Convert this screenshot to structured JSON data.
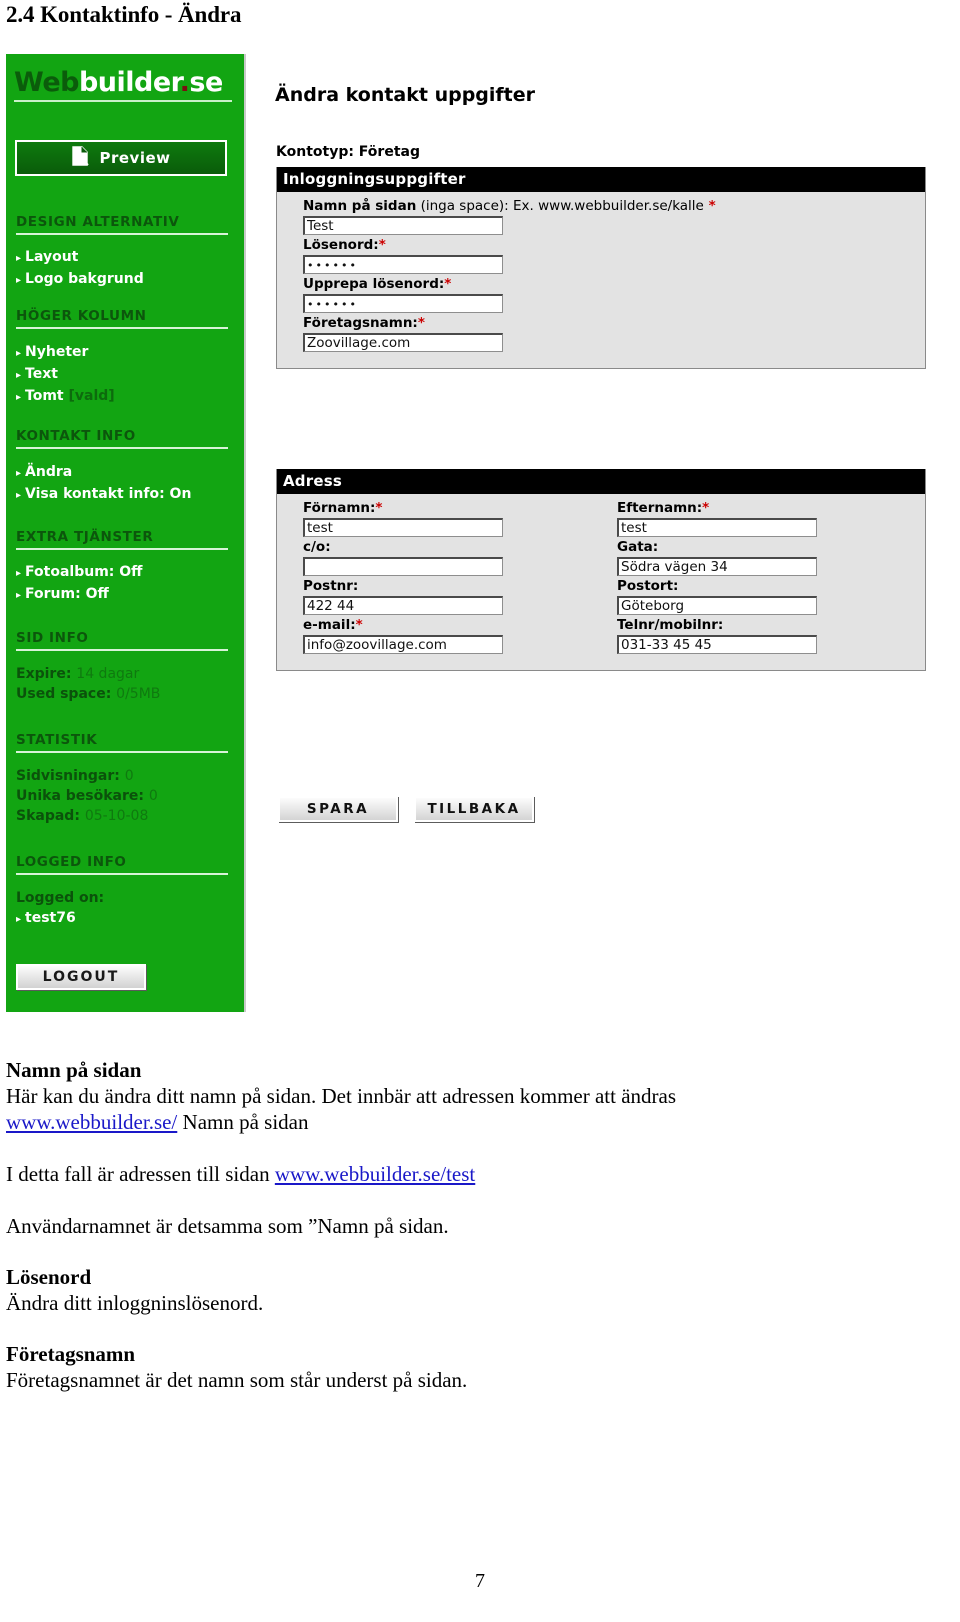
{
  "document": {
    "heading": "2.4 Kontaktinfo - Ändra",
    "page_number": "7"
  },
  "screenshot": {
    "sidebar": {
      "logo": {
        "part1": "Web",
        "part2": "builder",
        "dot": ".",
        "part3": "se"
      },
      "preview_button": {
        "label": "Preview",
        "icon": "page-preview-icon"
      },
      "sections": [
        {
          "title": "DESIGN ALTERNATIV",
          "items": [
            {
              "label": "Layout",
              "suffix": ""
            },
            {
              "label": "Logo bakgrund",
              "suffix": ""
            }
          ]
        },
        {
          "title": "HÖGER KOLUMN",
          "items": [
            {
              "label": "Nyheter",
              "suffix": ""
            },
            {
              "label": "Text",
              "suffix": ""
            },
            {
              "label": "Tomt",
              "suffix": "[vald]"
            }
          ]
        },
        {
          "title": "KONTAKT INFO",
          "items": [
            {
              "label": "Ändra",
              "suffix": ""
            },
            {
              "label": "Visa kontakt info: On",
              "suffix": ""
            }
          ]
        },
        {
          "title": "EXTRA TJÄNSTER",
          "items": [
            {
              "label": "Fotoalbum: Off",
              "suffix": ""
            },
            {
              "label": "Forum: Off",
              "suffix": ""
            }
          ]
        }
      ],
      "sid_info": {
        "title": "SID INFO",
        "rows": [
          {
            "key": "Expire:",
            "value": "14 dagar"
          },
          {
            "key": "Used space:",
            "value": "0/5MB"
          }
        ]
      },
      "statistik": {
        "title": "STATISTIK",
        "rows": [
          {
            "key": "Sidvisningar:",
            "value": "0"
          },
          {
            "key": "Unika besökare:",
            "value": "0"
          },
          {
            "key": "Skapad:",
            "value": "05-10-08"
          }
        ]
      },
      "logged_info": {
        "title": "LOGGED INFO",
        "label": "Logged on:",
        "user": "test76"
      },
      "logout_button": "LOGOUT"
    },
    "main": {
      "title": "Ändra kontakt uppgifter",
      "kontotyp": "Kontotyp: Företag",
      "login_panel": {
        "header": "Inloggningsuppgifter",
        "fields": [
          {
            "label_bold": "Namn på sidan",
            "label_normal": " (inga space): Ex. www.webbuilder.se/kalle",
            "required": "*",
            "value": "Test",
            "masked": false
          },
          {
            "label_bold": "Lösenord:",
            "label_normal": "",
            "required": "*",
            "value": "••••••",
            "masked": true
          },
          {
            "label_bold": "Upprepa lösenord:",
            "label_normal": "",
            "required": "*",
            "value": "••••••",
            "masked": true
          },
          {
            "label_bold": "Företagsnamn:",
            "label_normal": "",
            "required": "*",
            "value": "Zoovillage.com",
            "masked": false
          }
        ]
      },
      "address_panel": {
        "header": "Adress",
        "left_fields": [
          {
            "label_bold": "Förnamn:",
            "required": "*",
            "value": "test"
          },
          {
            "label_bold": "c/o:",
            "required": "",
            "value": ""
          },
          {
            "label_bold": "Postnr:",
            "required": "",
            "value": "422 44"
          },
          {
            "label_bold": "e-mail:",
            "required": "*",
            "value": "info@zoovillage.com"
          }
        ],
        "right_fields": [
          {
            "label_bold": "Efternamn:",
            "required": "*",
            "value": "test"
          },
          {
            "label_bold": "Gata:",
            "required": "",
            "value": "Södra vägen 34"
          },
          {
            "label_bold": "Postort:",
            "required": "",
            "value": "Göteborg"
          },
          {
            "label_bold": "Telnr/mobilnr:",
            "required": "",
            "value": "031-33 45 45"
          }
        ]
      },
      "save_button": "SPARA",
      "back_button": "TILLBAKA"
    }
  },
  "prose": {
    "s1_heading": "Namn på sidan",
    "s1_line1": "Här kan du ändra ditt namn  på sidan. Det innbär att adressen kommer att ändras",
    "s1_link": "www.webbuilder.se/",
    "s1_after_link": " Namn på sidan",
    "s2_before_link": "I detta fall är adressen till sidan ",
    "s2_link": "www.webbuilder.se/test",
    "s3_line": "Användarnamnet är detsamma som ”Namn på sidan.",
    "s4_heading": "Lösenord",
    "s4_line": "Ändra ditt inloggninslösenord.",
    "s5_heading": "Företagsnamn",
    "s5_line": "Företagsnamnet är det namn som står underst på sidan."
  },
  "colors": {
    "sidebar_green": "#12a512",
    "panel_gray": "#e3e3e3",
    "header_black": "#000000",
    "required_red": "#cc0000",
    "link_blue": "#1a18c8"
  }
}
